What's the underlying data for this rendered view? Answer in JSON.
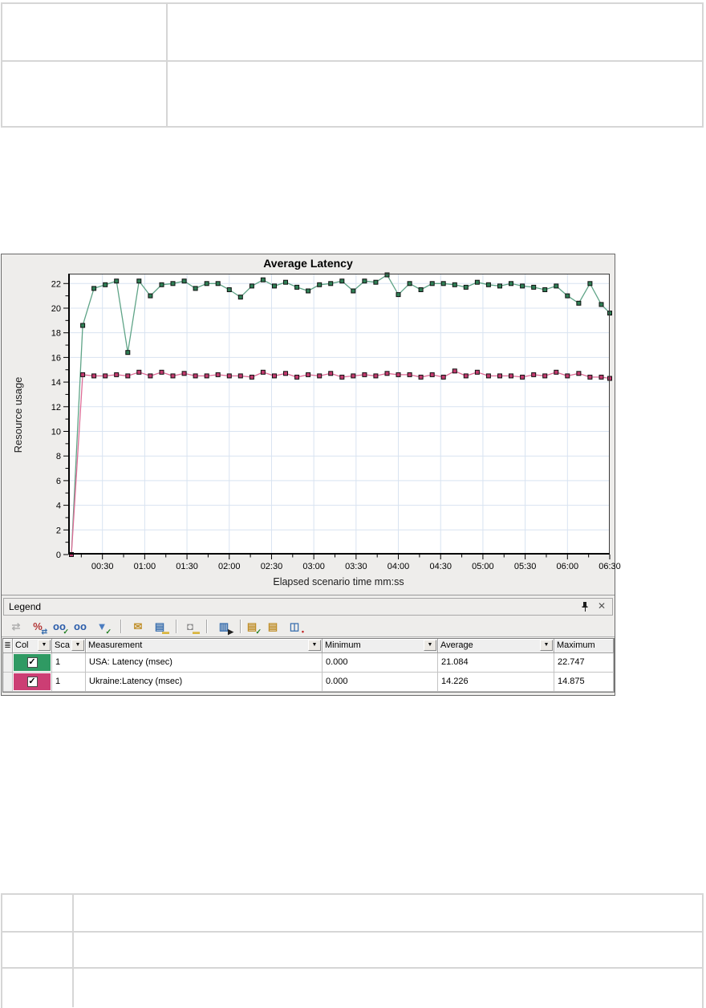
{
  "top_table": {
    "rows": [
      [
        "",
        ""
      ],
      [
        "",
        ""
      ]
    ]
  },
  "bottom_table": {
    "rows": [
      [
        "",
        ""
      ],
      [
        "",
        ""
      ],
      [
        "",
        ""
      ]
    ]
  },
  "chart_window": {
    "title": "Average Latency",
    "ylabel": "Resource usage",
    "xlabel": "Elapsed scenario time mm:ss"
  },
  "legend": {
    "panel_title": "Legend",
    "pin_icon": "pin",
    "close_icon": "✕",
    "toolbar_icons": [
      {
        "name": "gray-arrows-icon",
        "glyph": "⇄",
        "color": "#9c9c9c",
        "disabled": true
      },
      {
        "name": "percent-arrows-icon",
        "glyph": "%",
        "color": "#b23535",
        "badge": "⇄",
        "badge_color": "#3a6fae"
      },
      {
        "name": "glasses-check-icon",
        "glyph": "oo",
        "color": "#2a5caa",
        "badge": "✓",
        "badge_color": "#1c7c1c"
      },
      {
        "name": "glasses-icon",
        "glyph": "oo",
        "color": "#2a5caa"
      },
      {
        "name": "filter-check-icon",
        "glyph": "▼",
        "color": "#4a7cc0",
        "badge": "✓",
        "badge_color": "#1c7c1c"
      },
      {
        "name": "envelope-icon",
        "glyph": "✉",
        "color": "#c08f2a"
      },
      {
        "name": "page-ruler-icon",
        "glyph": "▤",
        "color": "#3a6fae",
        "badge": "▬",
        "badge_color": "#d9b53f"
      },
      {
        "name": "camera-icon",
        "glyph": "◘",
        "color": "#8a8a8a",
        "badge": "▬",
        "badge_color": "#d9b53f"
      },
      {
        "name": "columns-pointer-icon",
        "glyph": "▥",
        "color": "#3a6fae",
        "badge": "▶",
        "badge_color": "#222222"
      },
      {
        "name": "ruler-check-icon",
        "glyph": "▤",
        "color": "#c08f2a",
        "badge": "✓",
        "badge_color": "#1c7c1c"
      },
      {
        "name": "ruler-icon",
        "glyph": "▤",
        "color": "#c08f2a"
      },
      {
        "name": "grid-settings-icon",
        "glyph": "◫",
        "color": "#3a6fae",
        "badge": "•",
        "badge_color": "#c02020"
      }
    ],
    "table": {
      "columns": [
        "≣",
        "Col",
        "Sca",
        "Measurement",
        "Minimum",
        "Average",
        "Maximum"
      ],
      "dropdown_columns": [
        "Col",
        "Sca",
        "Measurement",
        "Minimum",
        "Average"
      ],
      "rows": [
        {
          "id": "usa",
          "color": "#2f9a63",
          "checked": true,
          "scale": "1",
          "measurement": "USA: Latency (msec)",
          "minimum": "0.000",
          "average": "21.084",
          "maximum": "22.747"
        },
        {
          "id": "ukraine",
          "color": "#cc3e74",
          "checked": true,
          "scale": "1",
          "measurement": "Ukraine:Latency (msec)",
          "minimum": "0.000",
          "average": "14.226",
          "maximum": "14.875"
        }
      ]
    }
  },
  "chart_data": {
    "type": "line",
    "title": "Average Latency",
    "xlabel": "Elapsed scenario time mm:ss",
    "ylabel": "Resource usage",
    "legend_position": "bottom-panel",
    "grid": true,
    "grid_color": "#d8e3f1",
    "xlim_seconds": [
      5.7,
      390
    ],
    "ylim": [
      0,
      22.8
    ],
    "y_ticks": [
      0,
      2,
      4,
      6,
      8,
      10,
      12,
      14,
      16,
      18,
      20,
      22
    ],
    "x_tick_seconds": [
      30,
      60,
      90,
      120,
      150,
      180,
      210,
      240,
      270,
      300,
      330,
      360,
      390
    ],
    "x_tick_labels": [
      "00:30",
      "01:00",
      "01:30",
      "02:00",
      "02:30",
      "03:00",
      "03:30",
      "04:00",
      "04:30",
      "05:00",
      "05:30",
      "06:00",
      "06:30"
    ],
    "series": [
      {
        "id": "usa",
        "name": "USA: Latency (msec)",
        "line_color": "#5fa487",
        "marker_color": "#2f7f55",
        "x": [
          8,
          16,
          24,
          32,
          40,
          48,
          56,
          64,
          72,
          80,
          88,
          96,
          104,
          112,
          120,
          128,
          136,
          144,
          152,
          160,
          168,
          176,
          184,
          192,
          200,
          208,
          216,
          224,
          232,
          240,
          248,
          256,
          264,
          272,
          280,
          288,
          296,
          304,
          312,
          320,
          328,
          336,
          344,
          352,
          360,
          368,
          376,
          384,
          390
        ],
        "values": [
          0,
          18.6,
          21.6,
          21.9,
          22.2,
          16.4,
          22.2,
          21.0,
          21.9,
          22.0,
          22.2,
          21.6,
          22.0,
          22.0,
          21.5,
          20.9,
          21.8,
          22.3,
          21.8,
          22.1,
          21.7,
          21.4,
          21.9,
          22.0,
          22.2,
          21.4,
          22.2,
          22.1,
          22.7,
          21.1,
          22.0,
          21.5,
          22.0,
          22.0,
          21.9,
          21.7,
          22.1,
          21.9,
          21.8,
          22.0,
          21.8,
          21.7,
          21.5,
          21.8,
          21.0,
          20.4,
          22.0,
          20.3,
          19.6
        ]
      },
      {
        "id": "ukraine",
        "name": "Ukraine:Latency (msec)",
        "line_color": "#dd6d97",
        "marker_color": "#c23a6e",
        "x": [
          8,
          16,
          24,
          32,
          40,
          48,
          56,
          64,
          72,
          80,
          88,
          96,
          104,
          112,
          120,
          128,
          136,
          144,
          152,
          160,
          168,
          176,
          184,
          192,
          200,
          208,
          216,
          224,
          232,
          240,
          248,
          256,
          264,
          272,
          280,
          288,
          296,
          304,
          312,
          320,
          328,
          336,
          344,
          352,
          360,
          368,
          376,
          384,
          390
        ],
        "values": [
          0,
          14.6,
          14.5,
          14.5,
          14.6,
          14.5,
          14.8,
          14.5,
          14.8,
          14.5,
          14.7,
          14.5,
          14.5,
          14.6,
          14.5,
          14.5,
          14.4,
          14.8,
          14.5,
          14.7,
          14.4,
          14.6,
          14.5,
          14.7,
          14.4,
          14.5,
          14.6,
          14.5,
          14.7,
          14.6,
          14.6,
          14.4,
          14.6,
          14.4,
          14.9,
          14.5,
          14.8,
          14.5,
          14.5,
          14.5,
          14.4,
          14.6,
          14.5,
          14.8,
          14.5,
          14.7,
          14.4,
          14.4,
          14.3
        ]
      }
    ]
  }
}
